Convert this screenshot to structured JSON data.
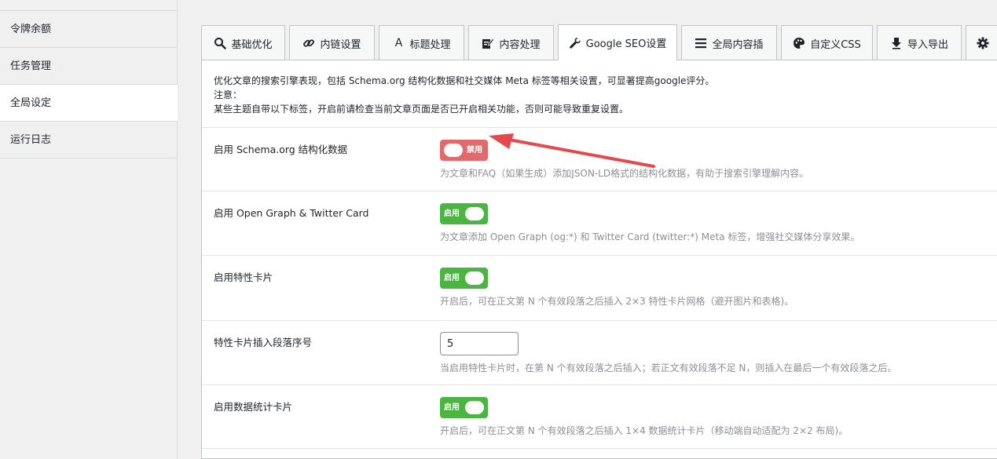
{
  "sidebar": {
    "items": [
      {
        "label": "令牌余额"
      },
      {
        "label": "任务管理"
      },
      {
        "label": "全局设定"
      },
      {
        "label": "运行日志"
      }
    ]
  },
  "tabs": [
    {
      "label": "基础优化",
      "icon": "search-icon"
    },
    {
      "label": "内链设置",
      "icon": "link-icon"
    },
    {
      "label": "标题处理",
      "icon": "text-icon"
    },
    {
      "label": "内容处理",
      "icon": "edit-icon"
    },
    {
      "label": "Google SEO设置",
      "icon": "wrench-icon"
    },
    {
      "label": "全局内容插",
      "icon": "list-icon"
    },
    {
      "label": "自定义CSS",
      "icon": "palette-icon"
    },
    {
      "label": "导入导出",
      "icon": "download-icon"
    },
    {
      "label": "",
      "icon": "gear-icon"
    }
  ],
  "intro": {
    "line1": "优化文章的搜索引擎表现，包括 Schema.org 结构化数据和社交媒体 Meta 标签等相关设置，可显著提高google评分。",
    "line2": "注意：",
    "line3": "某些主题自带以下标签，开启前请检查当前文章页面是否已开启相关功能，否则可能导致重复设置。"
  },
  "settings": {
    "schema": {
      "label": "启用 Schema.org 结构化数据",
      "state_label": "禁用",
      "enabled": false,
      "desc": "为文章和FAQ（如果生成）添加JSON-LD格式的结构化数据，有助于搜索引擎理解内容。"
    },
    "og": {
      "label": "启用 Open Graph & Twitter Card",
      "state_label": "启用",
      "enabled": true,
      "desc": "为文章添加 Open Graph (og:*) 和 Twitter Card (twitter:*) Meta 标签，增强社交媒体分享效果。"
    },
    "feature_card": {
      "label": "启用特性卡片",
      "state_label": "启用",
      "enabled": true,
      "desc": "开启后，可在正文第 N 个有效段落之后插入 2×3 特性卡片网格（避开图片和表格)。"
    },
    "feature_pos": {
      "label": "特性卡片插入段落序号",
      "value": "5",
      "desc": "当启用特性卡片时，在第 N 个有效段落之后插入；若正文有效段落不足 N，则插入在最后一个有效段落之后。"
    },
    "stats_card": {
      "label": "启用数据统计卡片",
      "state_label": "启用",
      "enabled": true,
      "desc": "开启后，可在正文第 N 个有效段落之后插入 1×4 数据统计卡片（移动端自动适配为 2×2 布局)。"
    }
  },
  "colors": {
    "toggle_on": "#4ab540",
    "toggle_off": "#e26a6d",
    "arrow": "#e5484d"
  }
}
